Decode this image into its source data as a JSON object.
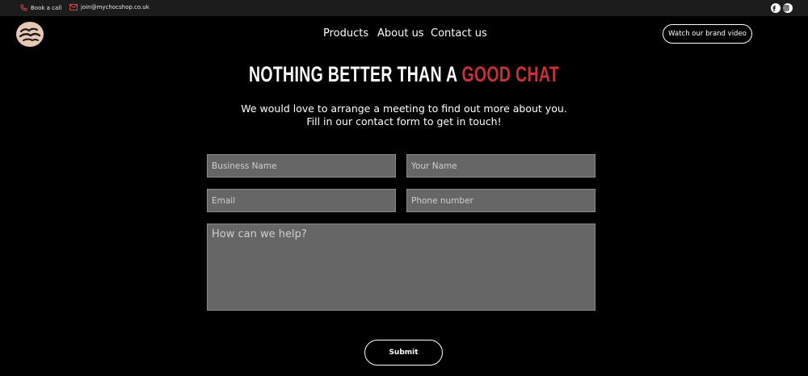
{
  "topbar": {
    "call_label": "Book a call",
    "email_label": "join@mychocshop.co.uk",
    "social": [
      {
        "icon": "facebook-icon"
      },
      {
        "icon": "instagram-icon"
      }
    ]
  },
  "header": {
    "logo_alt": "My Chocolate Shop",
    "nav": [
      "Products",
      "About us",
      "Contact us"
    ],
    "video_button": "Watch our brand video"
  },
  "hero": {
    "headline_main": "NOTHING BETTER THAN A ",
    "headline_accent": "GOOD CHAT",
    "intro_line1": "We would love to arrange a meeting to find out more about you.",
    "intro_line2": "Fill in our contact form to get in touch!"
  },
  "form": {
    "business_placeholder": "Business Name",
    "name_placeholder": "Your Name",
    "email_placeholder": "Email",
    "phone_placeholder": "Phone number",
    "message_placeholder": "How can we help?",
    "submit_label": "Submit"
  },
  "colors": {
    "accent": "#c7323a",
    "background": "#000000",
    "topbar": "#1c1c1c",
    "field": "#666666"
  }
}
